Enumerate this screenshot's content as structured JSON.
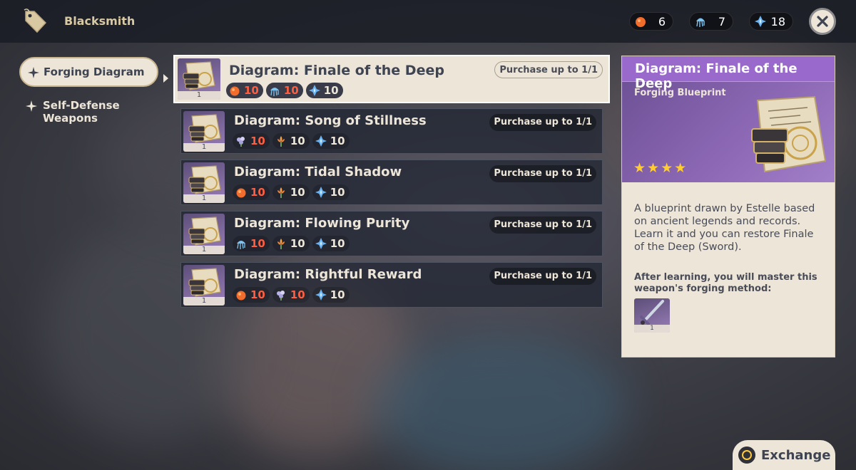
{
  "header": {
    "title": "Blacksmith",
    "icon": "shop-tag-icon",
    "currencies": [
      {
        "icon": "orange-fruit-icon",
        "value": "6"
      },
      {
        "icon": "blue-jellyfish-icon",
        "value": "7"
      },
      {
        "icon": "blue-crystal-icon",
        "value": "18"
      }
    ],
    "close_icon": "close-icon"
  },
  "sidebar": {
    "items": [
      {
        "label": "Forging Diagram",
        "active": true
      },
      {
        "label": "Self-Defense Weapons",
        "active": false
      }
    ]
  },
  "list": {
    "items": [
      {
        "title": "Diagram: Finale of the Deep",
        "limit": "Purchase up to 1/1",
        "qty": "1",
        "costs": [
          {
            "icon": "orange-fruit-icon",
            "value": "10",
            "insufficient": true
          },
          {
            "icon": "blue-jellyfish-icon",
            "value": "10",
            "insufficient": true
          },
          {
            "icon": "blue-crystal-icon",
            "value": "10",
            "insufficient": false
          }
        ]
      },
      {
        "title": "Diagram: Song of Stillness",
        "limit": "Purchase up to 1/1",
        "qty": "1",
        "costs": [
          {
            "icon": "flower-cluster-icon",
            "value": "10",
            "insufficient": true
          },
          {
            "icon": "orange-flower-icon",
            "value": "10",
            "insufficient": false
          },
          {
            "icon": "blue-crystal-icon",
            "value": "10",
            "insufficient": false
          }
        ]
      },
      {
        "title": "Diagram: Tidal Shadow",
        "limit": "Purchase up to 1/1",
        "qty": "1",
        "costs": [
          {
            "icon": "orange-fruit-icon",
            "value": "10",
            "insufficient": true
          },
          {
            "icon": "orange-flower-icon",
            "value": "10",
            "insufficient": false
          },
          {
            "icon": "blue-crystal-icon",
            "value": "10",
            "insufficient": false
          }
        ]
      },
      {
        "title": "Diagram: Flowing Purity",
        "limit": "Purchase up to 1/1",
        "qty": "1",
        "costs": [
          {
            "icon": "blue-jellyfish-icon",
            "value": "10",
            "insufficient": true
          },
          {
            "icon": "orange-flower-icon",
            "value": "10",
            "insufficient": false
          },
          {
            "icon": "blue-crystal-icon",
            "value": "10",
            "insufficient": false
          }
        ]
      },
      {
        "title": "Diagram: Rightful Reward",
        "limit": "Purchase up to 1/1",
        "qty": "1",
        "costs": [
          {
            "icon": "orange-fruit-icon",
            "value": "10",
            "insufficient": true
          },
          {
            "icon": "flower-cluster-icon",
            "value": "10",
            "insufficient": true
          },
          {
            "icon": "blue-crystal-icon",
            "value": "10",
            "insufficient": false
          }
        ]
      }
    ]
  },
  "detail": {
    "title": "Diagram: Finale of the Deep",
    "type": "Forging Blueprint",
    "rarity_stars": 4,
    "description": "A blueprint drawn by Estelle based on ancient legends and records. Learn it and you can restore Finale of the Deep (Sword).",
    "after_learning": "After learning, you will master this weapon's forging method:",
    "weapon_qty": "1",
    "weapon_icon": "sword-icon"
  },
  "footer": {
    "exchange_label": "Exchange"
  },
  "colors": {
    "accent_purple": "#9a69cc",
    "panel_beige": "#ece5d8",
    "insufficient_red": "#ff5f40",
    "star_gold": "#ffcc32"
  }
}
